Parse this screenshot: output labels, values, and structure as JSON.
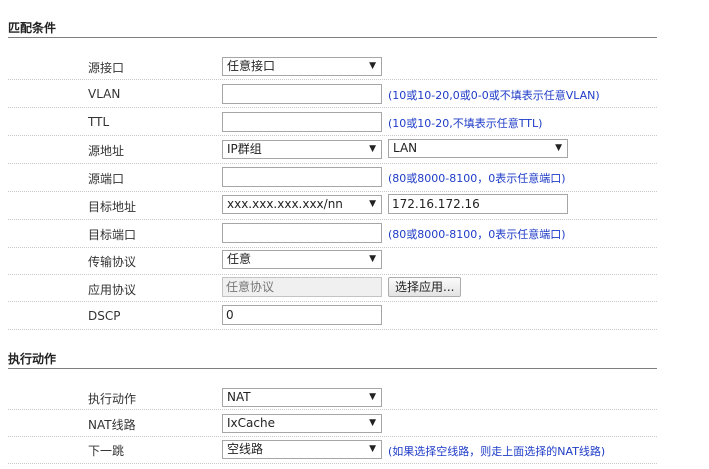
{
  "match_section": {
    "title": "匹配条件"
  },
  "action_section": {
    "title": "执行动作"
  },
  "match_rows": {
    "source_interface": {
      "label": "源接口",
      "value": "任意接口"
    },
    "vlan": {
      "label": "VLAN",
      "value": "",
      "hint": "(10或10-20,0或0-0或不填表示任意VLAN)"
    },
    "ttl": {
      "label": "TTL",
      "value": "",
      "hint": "(10或10-20,不填表示任意TTL)"
    },
    "source_address": {
      "label": "源地址",
      "type_value": "IP群组",
      "group_value": "LAN"
    },
    "source_port": {
      "label": "源端口",
      "value": "",
      "hint": "(80或8000-8100，0表示任意端口)"
    },
    "dest_address": {
      "label": "目标地址",
      "type_value": "xxx.xxx.xxx.xxx/nn",
      "value": "172.16.172.16"
    },
    "dest_port": {
      "label": "目标端口",
      "value": "",
      "hint": "(80或8000-8100，0表示任意端口)"
    },
    "transport_protocol": {
      "label": "传输协议",
      "value": "任意"
    },
    "app_protocol": {
      "label": "应用协议",
      "value": "任意协议",
      "button": "选择应用..."
    },
    "dscp": {
      "label": "DSCP",
      "value": "0"
    }
  },
  "action_rows": {
    "action": {
      "label": "执行动作",
      "value": "NAT"
    },
    "nat_line": {
      "label": "NAT线路",
      "value": "IxCache"
    },
    "next_hop": {
      "label": "下一跳",
      "value": "空线路",
      "hint": "(如果选择空线路，则走上面选择的NAT线路)"
    }
  }
}
